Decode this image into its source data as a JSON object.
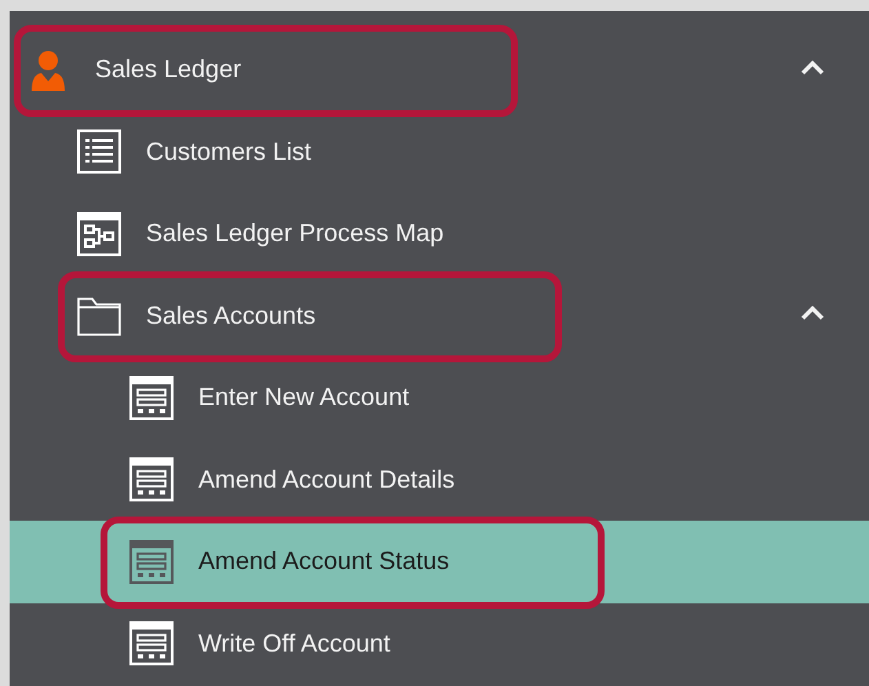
{
  "tree": [
    {
      "label": "Sales Ledger",
      "kind": "person",
      "selected": false,
      "highlighted": true,
      "expanded": true,
      "children": [
        {
          "label": "Customers List",
          "kind": "list",
          "selected": false,
          "highlighted": false
        },
        {
          "label": "Sales Ledger Process Map",
          "kind": "process-map",
          "selected": false,
          "highlighted": false
        },
        {
          "label": "Sales Accounts",
          "kind": "folder",
          "selected": false,
          "highlighted": true,
          "expanded": true,
          "children": [
            {
              "label": "Enter New Account",
              "kind": "form",
              "selected": false,
              "highlighted": false
            },
            {
              "label": "Amend Account Details",
              "kind": "form",
              "selected": false,
              "highlighted": false
            },
            {
              "label": "Amend Account Status",
              "kind": "form",
              "selected": true,
              "highlighted": true
            },
            {
              "label": "Write Off Account",
              "kind": "form",
              "selected": false,
              "highlighted": false
            }
          ]
        }
      ]
    }
  ]
}
